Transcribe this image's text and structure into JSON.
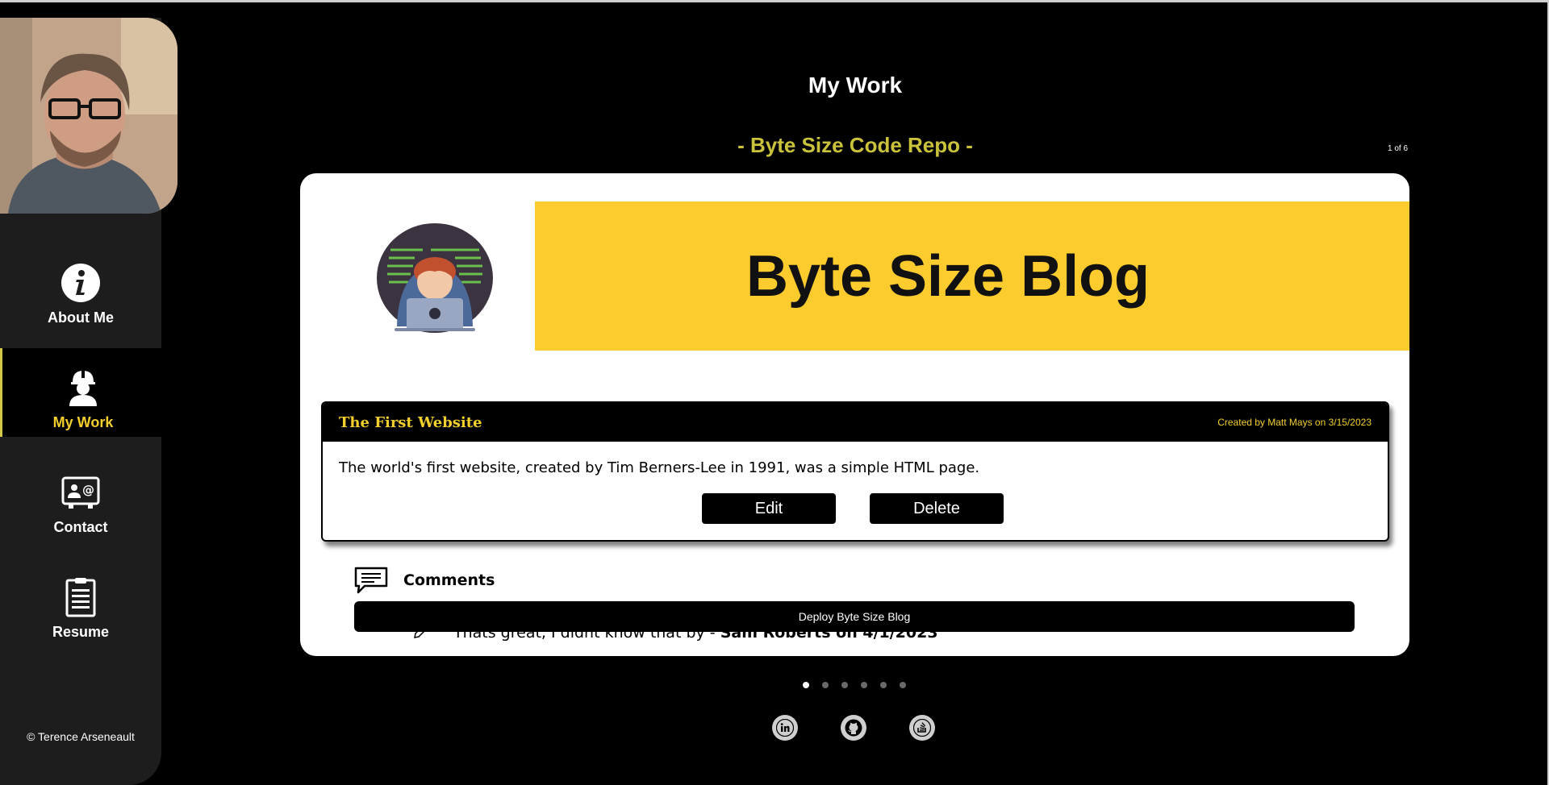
{
  "header": {
    "page_title": "My Work",
    "project_title": "- Byte Size Code Repo -",
    "slide_counter": "1 of 6"
  },
  "sidebar": {
    "items": [
      {
        "label": "About Me",
        "icon": "info-icon",
        "active": false
      },
      {
        "label": "My Work",
        "icon": "worker-icon",
        "active": true
      },
      {
        "label": "Contact",
        "icon": "contact-card-icon",
        "active": false
      },
      {
        "label": "Resume",
        "icon": "document-icon",
        "active": false
      }
    ],
    "copyright": "© Terence Arseneault"
  },
  "card": {
    "banner_text": "Byte Size Blog",
    "post": {
      "title": "The First Website",
      "meta": "Created by Matt Mays on 3/15/2023",
      "body": "The world's first website, created by Tim Berners-Lee in 1991, was a simple HTML page.",
      "edit_label": "Edit",
      "delete_label": "Delete"
    },
    "comments_label": "Comments",
    "comment": {
      "text": "Thats great, I didnt know that by - ",
      "author": "Sam Roberts on 4/1/2023"
    },
    "deploy_label": "Deploy Byte Size Blog"
  },
  "pagination": {
    "total": 6,
    "active_index": 0
  },
  "social": [
    "linkedin-icon",
    "github-icon",
    "stackoverflow-icon"
  ],
  "colors": {
    "accent_yellow": "#f2cf2c",
    "banner_yellow": "#fccb2e",
    "title_olive": "#c9c23a",
    "sidebar_bg": "#1d1d1d"
  }
}
